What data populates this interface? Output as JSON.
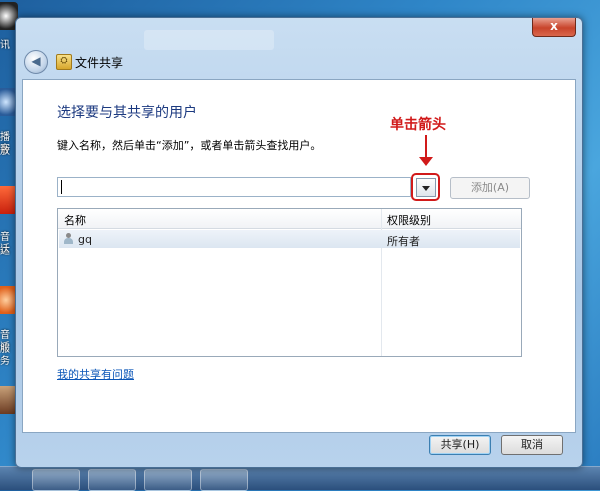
{
  "desktop": {
    "labels": [
      "讯",
      "播客",
      "放",
      "音迁",
      "达",
      "音迁",
      "服务"
    ]
  },
  "window": {
    "title": "文件共享",
    "close_label": "x"
  },
  "content": {
    "heading": "选择要与其共享的用户",
    "instruction": "键入名称，然后单击“添加”，或者单击箭头查找用户。",
    "annotation": "单击箭头",
    "name_input": {
      "value": "",
      "placeholder": ""
    },
    "add_button": "添加(A)",
    "table": {
      "columns": [
        "名称",
        "权限级别"
      ],
      "rows": [
        {
          "name": "gq",
          "permission": "所有者"
        }
      ]
    },
    "problem_link": "我的共享有问题"
  },
  "footer": {
    "share_button": "共享(H)",
    "cancel_button": "取消"
  },
  "colors": {
    "annotation": "#d11a1a",
    "heading": "#1c3a80",
    "link": "#0b56b8"
  }
}
